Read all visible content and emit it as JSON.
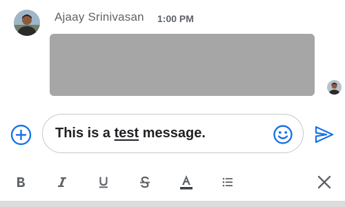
{
  "message": {
    "sender_name": "Ajaay Srinivasan",
    "time": "1:00 PM",
    "attachment_color": "#a6a6a6"
  },
  "composer": {
    "text_before": "This is a ",
    "text_underlined": "test",
    "text_after": " message."
  },
  "icons": {
    "add": "plus-circle-icon",
    "emoji": "smiley-icon",
    "send": "send-icon",
    "bold": "bold-icon",
    "italic": "italic-icon",
    "underline": "underline-icon",
    "strikethrough": "strikethrough-icon",
    "text_color": "text-color-icon",
    "list": "bulleted-list-icon",
    "close": "close-icon"
  },
  "colors": {
    "accent": "#1a73e8",
    "icon_gray": "#5f6368",
    "text": "#202124"
  }
}
